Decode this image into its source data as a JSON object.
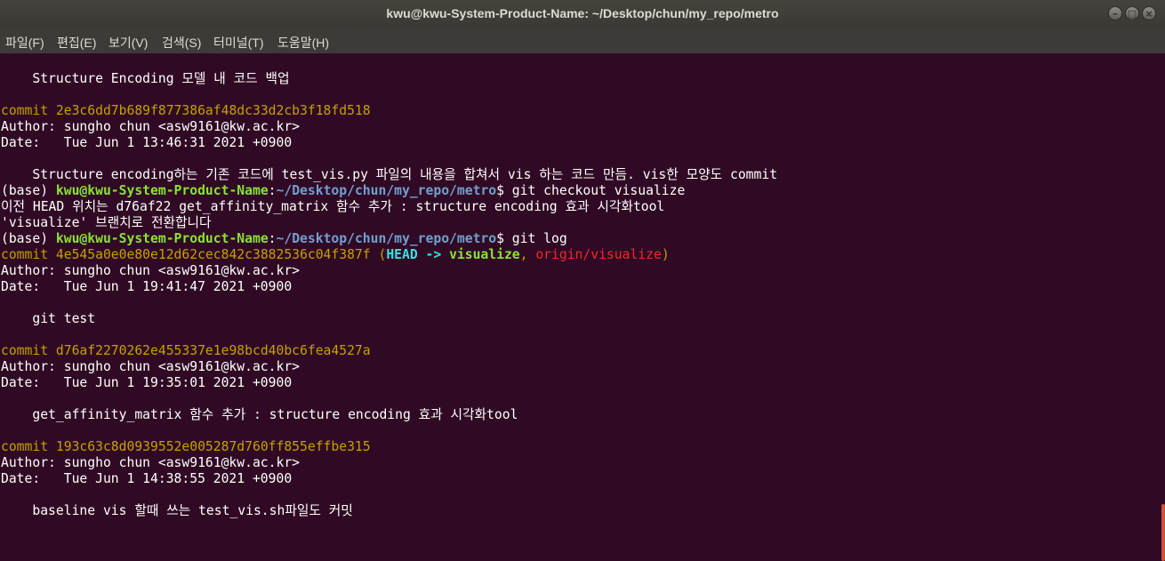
{
  "window": {
    "title": "kwu@kwu-System-Product-Name: ~/Desktop/chun/my_repo/metro",
    "buttons": {
      "minimize": "–",
      "maximize": "□",
      "close": "×"
    }
  },
  "menu": [
    "파일(F)",
    "편집(E)",
    "보기(V)",
    "검색(S)",
    "터미널(T)",
    "도움말(H)"
  ],
  "terminal": {
    "l1": "    Structure Encoding 모델 내 코드 백업",
    "commit_word": "commit",
    "c1_hash": "2e3c6dd7b689f877386af48dc33d2cb3f18fd518",
    "c1_author": "Author: sungho chun <asw9161@kw.ac.kr>",
    "c1_date": "Date:   Tue Jun 1 13:46:31 2021 +0900",
    "c1_msg": "    Structure encoding하는 기존 코드에 test_vis.py 파일의 내용을 합쳐서 vis 하는 코드 만듬. vis한 모양도 commit",
    "prompt_base": "(base) ",
    "prompt_user": "kwu@kwu-System-Product-Name",
    "prompt_colon": ":",
    "prompt_path": "~/Desktop/chun/my_repo/metro",
    "cmd1": "$ git checkout visualize",
    "out1": "이전 HEAD 위치는 d76af22 get_affinity_matrix 함수 추가 : structure encoding 효과 시각화tool",
    "out2": "'visualize' 브랜치로 전환합니다",
    "cmd2": "$ git log",
    "c2_hash": "4e545a0e0e80e12d62cec842c3882536c04f387f",
    "c2_paren_open": " (",
    "c2_head": "HEAD -> ",
    "c2_branch": "visualize",
    "c2_sep": ", ",
    "c2_origin": "origin/visualize",
    "c2_paren_close": ")",
    "c2_author": "Author: sungho chun <asw9161@kw.ac.kr>",
    "c2_date": "Date:   Tue Jun 1 19:41:47 2021 +0900",
    "c2_msg": "    git test",
    "c3_hash": "d76af2270262e455337e1e98bcd40bc6fea4527a",
    "c3_author": "Author: sungho chun <asw9161@kw.ac.kr>",
    "c3_date": "Date:   Tue Jun 1 19:35:01 2021 +0900",
    "c3_msg": "    get_affinity_matrix 함수 추가 : structure encoding 효과 시각화tool",
    "c4_hash": "193c63c8d0939552e005287d760ff855effbe315",
    "c4_author": "Author: sungho chun <asw9161@kw.ac.kr>",
    "c4_date": "Date:   Tue Jun 1 14:38:55 2021 +0900",
    "c4_msg": "    baseline vis 할때 쓰는 test_vis.sh파일도 커밋"
  },
  "colors": {
    "background": "#300a24",
    "commit_yellow": "#c4a000",
    "prompt_green": "#8ae234",
    "path_blue": "#729fcf",
    "head_cyan": "#34e2e2",
    "origin_red": "#ef2929",
    "scroll_thumb": "#d0543a"
  }
}
